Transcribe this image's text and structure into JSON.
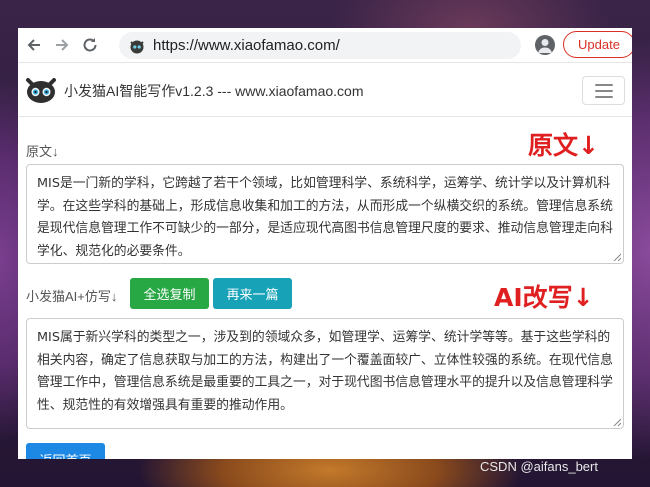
{
  "browser": {
    "back_icon": "arrow-left-icon",
    "forward_icon": "arrow-right-icon",
    "reload_icon": "reload-icon",
    "url": "https://www.xiaofamao.com/",
    "update_label": "Update"
  },
  "navbar": {
    "brand": "小发猫AI智能写作v1.2.3 --- www.xiaofamao.com"
  },
  "original": {
    "label": "原文↓",
    "heading": "原文↓",
    "text": "MIS是一门新的学科，它跨越了若干个领域，比如管理科学、系统科学，运筹学、统计学以及计算机科学。在这些学科的基础上，形成信息收集和加工的方法，从而形成一个纵横交织的系统。管理信息系统是现代信息管理工作不可缺少的一部分，是适应现代高图书信息管理尺度的要求、推动信息管理走向科学化、规范化的必要条件。"
  },
  "rewrite": {
    "label": "小发猫AI+仿写↓",
    "heading": "AI改写↓",
    "select_all_label": "全选复制",
    "again_label": "再来一篇",
    "text": "MIS属于新兴学科的类型之一，涉及到的领域众多，如管理学、运筹学、统计学等等。基于这些学科的相关内容，确定了信息获取与加工的方法，构建出了一个覆盖面较广、立体性较强的系统。在现代信息管理工作中，管理信息系统是最重要的工具之一，对于现代图书信息管理水平的提升以及信息管理科学性、规范性的有效增强具有重要的推动作用。"
  },
  "footer": {
    "back_button": "返回首页"
  },
  "watermark": "CSDN @aifans_bert",
  "colors": {
    "accent_red": "#e02020",
    "green_button": "#28a745",
    "teal_button": "#17a2b8",
    "blue_button": "#1e88e5",
    "update_red": "#d93025"
  }
}
